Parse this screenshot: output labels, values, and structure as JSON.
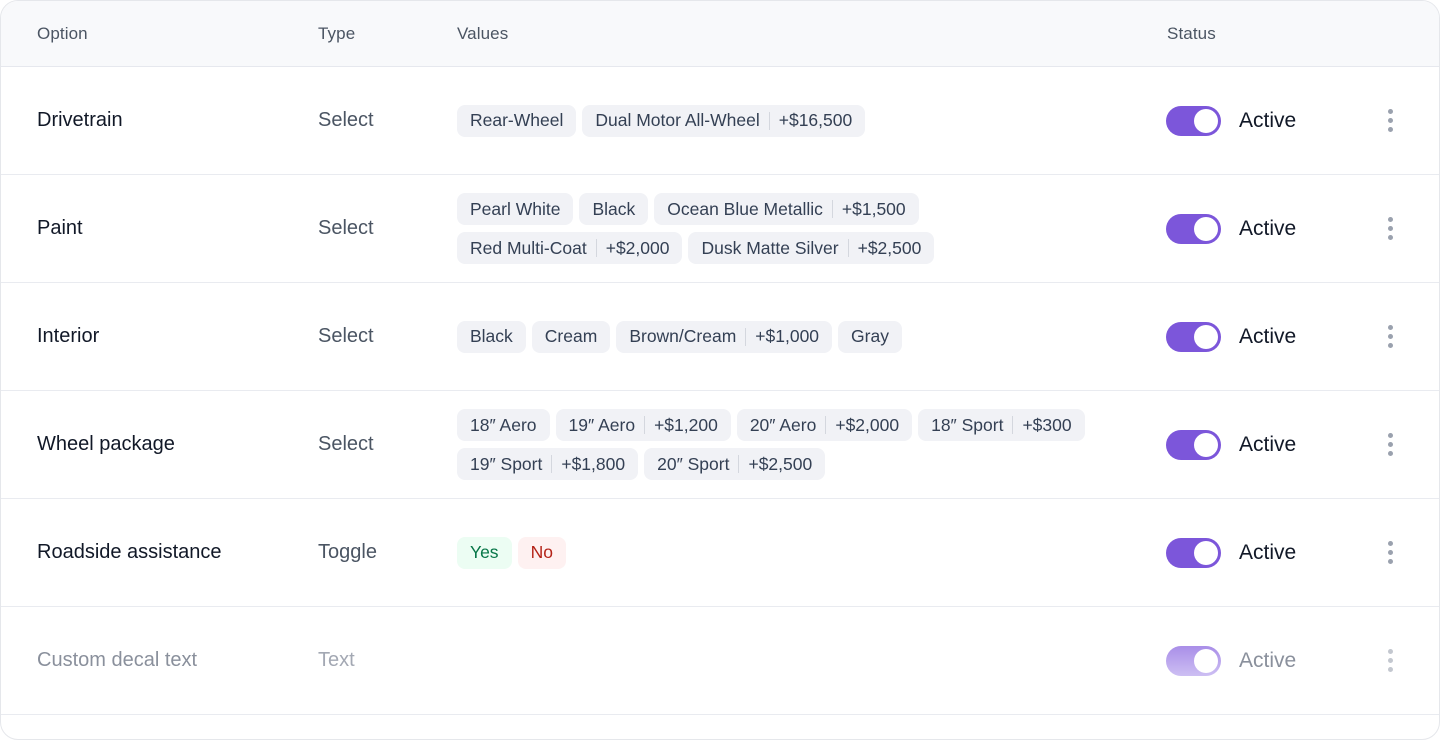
{
  "table": {
    "headers": {
      "option": "Option",
      "type": "Type",
      "values": "Values",
      "status": "Status"
    },
    "rows": [
      {
        "option": "Drivetrain",
        "type": "Select",
        "status": "Active",
        "active": true,
        "values": [
          {
            "label": "Rear-Wheel",
            "price": null
          },
          {
            "label": "Dual Motor All-Wheel",
            "price": "+$16,500"
          }
        ]
      },
      {
        "option": "Paint",
        "type": "Select",
        "status": "Active",
        "active": true,
        "values": [
          {
            "label": "Pearl White",
            "price": null
          },
          {
            "label": "Black",
            "price": null
          },
          {
            "label": "Ocean Blue Metallic",
            "price": "+$1,500"
          },
          {
            "label": "Red Multi-Coat",
            "price": "+$2,000"
          },
          {
            "label": "Dusk Matte Silver",
            "price": "+$2,500"
          }
        ]
      },
      {
        "option": "Interior",
        "type": "Select",
        "status": "Active",
        "active": true,
        "values": [
          {
            "label": "Black",
            "price": null
          },
          {
            "label": "Cream",
            "price": null
          },
          {
            "label": "Brown/Cream",
            "price": "+$1,000"
          },
          {
            "label": "Gray",
            "price": null
          }
        ]
      },
      {
        "option": "Wheel package",
        "type": "Select",
        "status": "Active",
        "active": true,
        "values": [
          {
            "label": "18″ Aero",
            "price": null
          },
          {
            "label": "19″ Aero",
            "price": "+$1,200"
          },
          {
            "label": "20″ Aero",
            "price": "+$2,000"
          },
          {
            "label": "18″ Sport",
            "price": "+$300"
          },
          {
            "label": "19″ Sport",
            "price": "+$1,800"
          },
          {
            "label": "20″ Sport",
            "price": "+$2,500"
          }
        ]
      },
      {
        "option": "Roadside assistance",
        "type": "Toggle",
        "status": "Active",
        "active": true,
        "values": [
          {
            "label": "Yes",
            "price": null,
            "variant": "yes"
          },
          {
            "label": "No",
            "price": null,
            "variant": "no"
          }
        ]
      },
      {
        "option": "Custom decal text",
        "type": "Text",
        "status": "Active",
        "active": true,
        "faded": true,
        "values": []
      }
    ]
  },
  "icons": {
    "row_menu": "kebab-vertical-icon",
    "status_toggle": "toggle-switch-icon"
  },
  "colors": {
    "accent": "#7c56da",
    "yes_text": "#067647",
    "yes_bg": "#ecfdf3",
    "no_text": "#b42318",
    "no_bg": "#fef1f1"
  }
}
